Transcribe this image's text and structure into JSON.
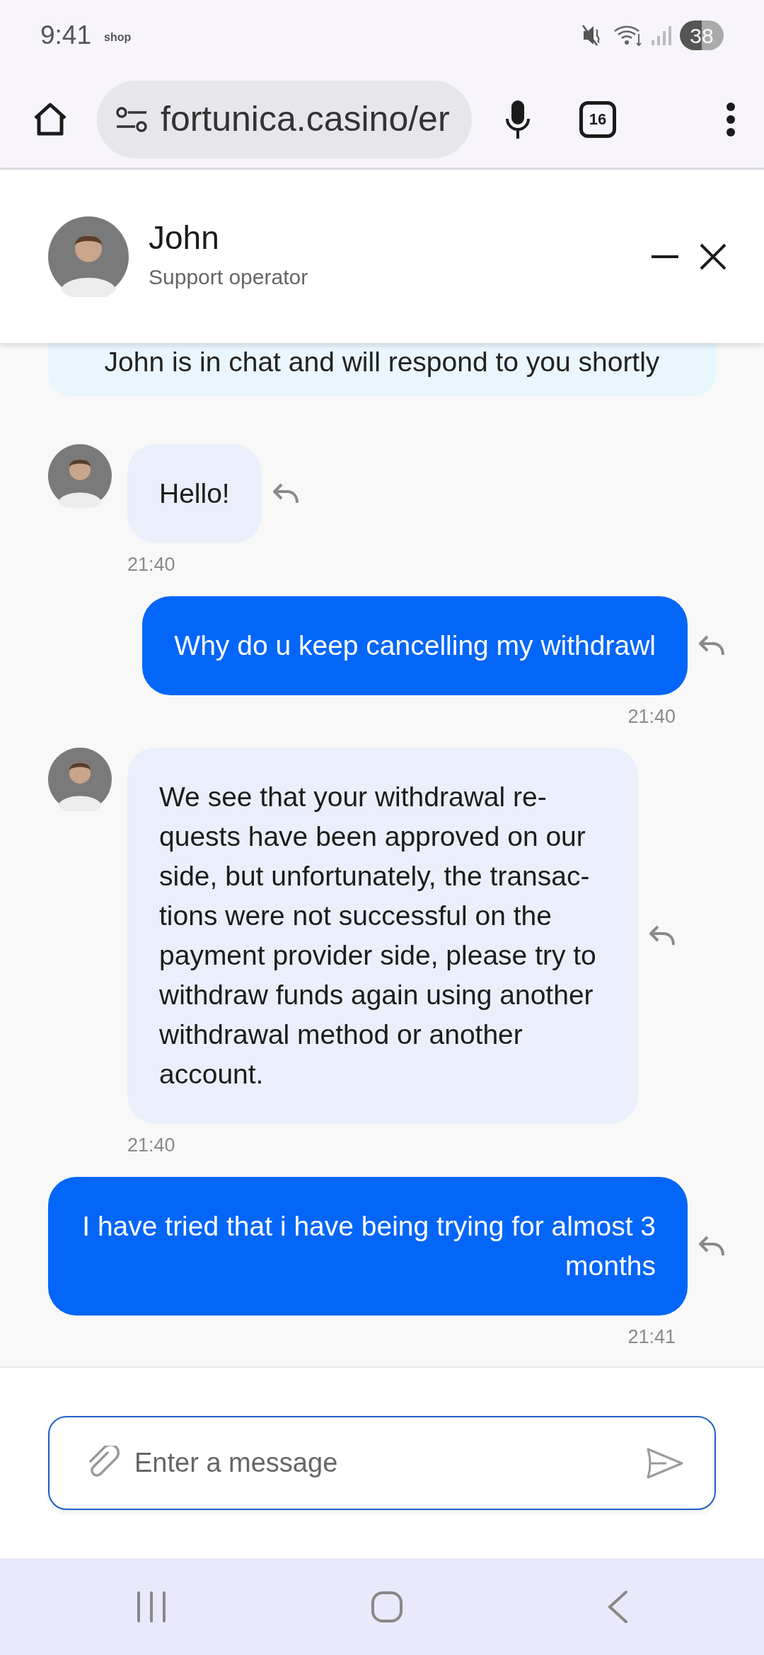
{
  "status_bar": {
    "time": "9:41",
    "carrier": "shop",
    "battery": "38"
  },
  "browser": {
    "url": "fortunica.casino/er",
    "tab_count": "16"
  },
  "chat_header": {
    "name": "John",
    "role": "Support operator"
  },
  "notice": "John is in chat and will respond to you shortly",
  "messages": [
    {
      "kind": "incoming",
      "text": "Hello!",
      "time": "21:40"
    },
    {
      "kind": "outgoing",
      "text": "Why do u keep cancelling my withdrawl",
      "time": "21:40"
    },
    {
      "kind": "incoming",
      "text": "We see that your withdrawal re-quests have been approved on our side, but unfortunately, the transac-tions were not successful on the payment provider side, please try to withdraw funds again using another withdrawal method or another account.",
      "time": "21:40"
    },
    {
      "kind": "outgoing",
      "text": "I have tried that i have being trying for almost 3 months",
      "time": "21:41"
    }
  ],
  "composer": {
    "placeholder": "Enter a message"
  }
}
